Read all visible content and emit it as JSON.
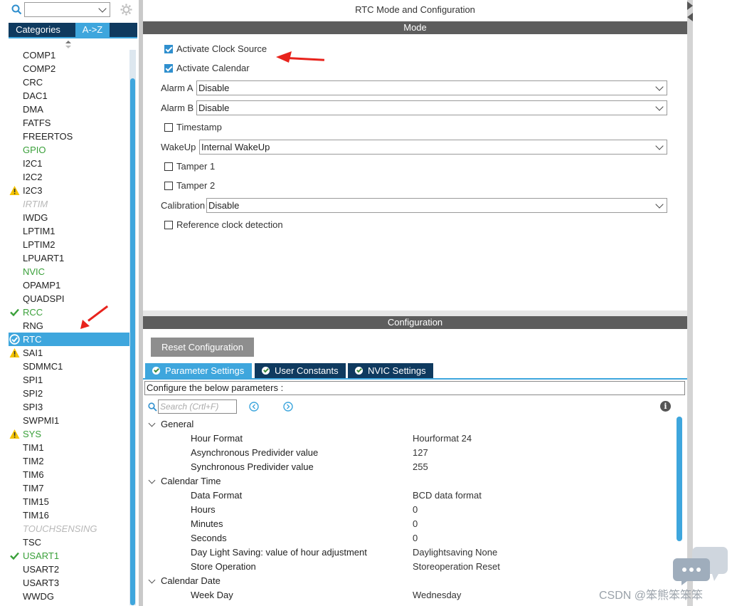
{
  "left_panel": {
    "tabs": [
      "Categories",
      "A->Z"
    ],
    "active_tab": 1,
    "peripherals": [
      {
        "label": "COMP1",
        "style": "normal",
        "icon": ""
      },
      {
        "label": "COMP2",
        "style": "normal",
        "icon": ""
      },
      {
        "label": "CRC",
        "style": "normal",
        "icon": ""
      },
      {
        "label": "DAC1",
        "style": "normal",
        "icon": ""
      },
      {
        "label": "DMA",
        "style": "normal",
        "icon": ""
      },
      {
        "label": "FATFS",
        "style": "normal",
        "icon": ""
      },
      {
        "label": "FREERTOS",
        "style": "normal",
        "icon": ""
      },
      {
        "label": "GPIO",
        "style": "green",
        "icon": ""
      },
      {
        "label": "I2C1",
        "style": "normal",
        "icon": ""
      },
      {
        "label": "I2C2",
        "style": "normal",
        "icon": ""
      },
      {
        "label": "I2C3",
        "style": "normal",
        "icon": "warning"
      },
      {
        "label": "IRTIM",
        "style": "gray",
        "icon": ""
      },
      {
        "label": "IWDG",
        "style": "normal",
        "icon": ""
      },
      {
        "label": "LPTIM1",
        "style": "normal",
        "icon": ""
      },
      {
        "label": "LPTIM2",
        "style": "normal",
        "icon": ""
      },
      {
        "label": "LPUART1",
        "style": "normal",
        "icon": ""
      },
      {
        "label": "NVIC",
        "style": "green",
        "icon": ""
      },
      {
        "label": "OPAMP1",
        "style": "normal",
        "icon": ""
      },
      {
        "label": "QUADSPI",
        "style": "normal",
        "icon": ""
      },
      {
        "label": "RCC",
        "style": "green",
        "icon": "check"
      },
      {
        "label": "RNG",
        "style": "normal",
        "icon": ""
      },
      {
        "label": "RTC",
        "style": "selected",
        "icon": "check-circle"
      },
      {
        "label": "SAI1",
        "style": "normal",
        "icon": "warning"
      },
      {
        "label": "SDMMC1",
        "style": "normal",
        "icon": ""
      },
      {
        "label": "SPI1",
        "style": "normal",
        "icon": ""
      },
      {
        "label": "SPI2",
        "style": "normal",
        "icon": ""
      },
      {
        "label": "SPI3",
        "style": "normal",
        "icon": ""
      },
      {
        "label": "SWPMI1",
        "style": "normal",
        "icon": ""
      },
      {
        "label": "SYS",
        "style": "green",
        "icon": "warning"
      },
      {
        "label": "TIM1",
        "style": "normal",
        "icon": ""
      },
      {
        "label": "TIM2",
        "style": "normal",
        "icon": ""
      },
      {
        "label": "TIM6",
        "style": "normal",
        "icon": ""
      },
      {
        "label": "TIM7",
        "style": "normal",
        "icon": ""
      },
      {
        "label": "TIM15",
        "style": "normal",
        "icon": ""
      },
      {
        "label": "TIM16",
        "style": "normal",
        "icon": ""
      },
      {
        "label": "TOUCHSENSING",
        "style": "gray",
        "icon": ""
      },
      {
        "label": "TSC",
        "style": "normal",
        "icon": ""
      },
      {
        "label": "USART1",
        "style": "green",
        "icon": "check"
      },
      {
        "label": "USART2",
        "style": "normal",
        "icon": ""
      },
      {
        "label": "USART3",
        "style": "normal",
        "icon": ""
      },
      {
        "label": "WWDG",
        "style": "normal",
        "icon": ""
      }
    ]
  },
  "mode_panel": {
    "title": "RTC Mode and Configuration",
    "header": "Mode",
    "activate_clock_source": {
      "label": "Activate Clock Source",
      "checked": true
    },
    "activate_calendar": {
      "label": "Activate Calendar",
      "checked": true
    },
    "alarm_a": {
      "label": "Alarm A",
      "value": "Disable"
    },
    "alarm_b": {
      "label": "Alarm B",
      "value": "Disable"
    },
    "timestamp": {
      "label": "Timestamp",
      "checked": false
    },
    "wakeup": {
      "label": "WakeUp",
      "value": "Internal WakeUp"
    },
    "tamper1": {
      "label": "Tamper 1",
      "checked": false
    },
    "tamper2": {
      "label": "Tamper 2",
      "checked": false
    },
    "calibration": {
      "label": "Calibration",
      "value": "Disable"
    },
    "reference_clock": {
      "label": "Reference clock detection",
      "checked": false
    }
  },
  "config_panel": {
    "header": "Configuration",
    "reset_button": "Reset Configuration",
    "tabs": [
      "Parameter Settings",
      "User Constants",
      "NVIC Settings"
    ],
    "active_tab": 0,
    "description": "Configure the below parameters :",
    "search_placeholder": "Search (Crtl+F)",
    "groups": [
      {
        "name": "General",
        "params": [
          {
            "name": "Hour Format",
            "value": "Hourformat 24"
          },
          {
            "name": "Asynchronous Predivider value",
            "value": "127"
          },
          {
            "name": "Synchronous Predivider value",
            "value": "255"
          }
        ]
      },
      {
        "name": "Calendar Time",
        "params": [
          {
            "name": "Data Format",
            "value": "BCD data format"
          },
          {
            "name": "Hours",
            "value": "0"
          },
          {
            "name": "Minutes",
            "value": "0"
          },
          {
            "name": "Seconds",
            "value": "0"
          },
          {
            "name": "Day Light Saving: value of hour adjustment",
            "value": "Daylightsaving None"
          },
          {
            "name": "Store Operation",
            "value": "Storeoperation Reset"
          }
        ]
      },
      {
        "name": "Calendar Date",
        "params": [
          {
            "name": "Week Day",
            "value": "Wednesday"
          }
        ]
      }
    ]
  },
  "watermark": "CSDN @笨熊笨笨笨",
  "colors": {
    "accent": "#3ea6dd",
    "dark_tab": "#0f3a5f",
    "header": "#5d5d5d",
    "green": "#3aa03a",
    "arrow": "#e8231c"
  }
}
